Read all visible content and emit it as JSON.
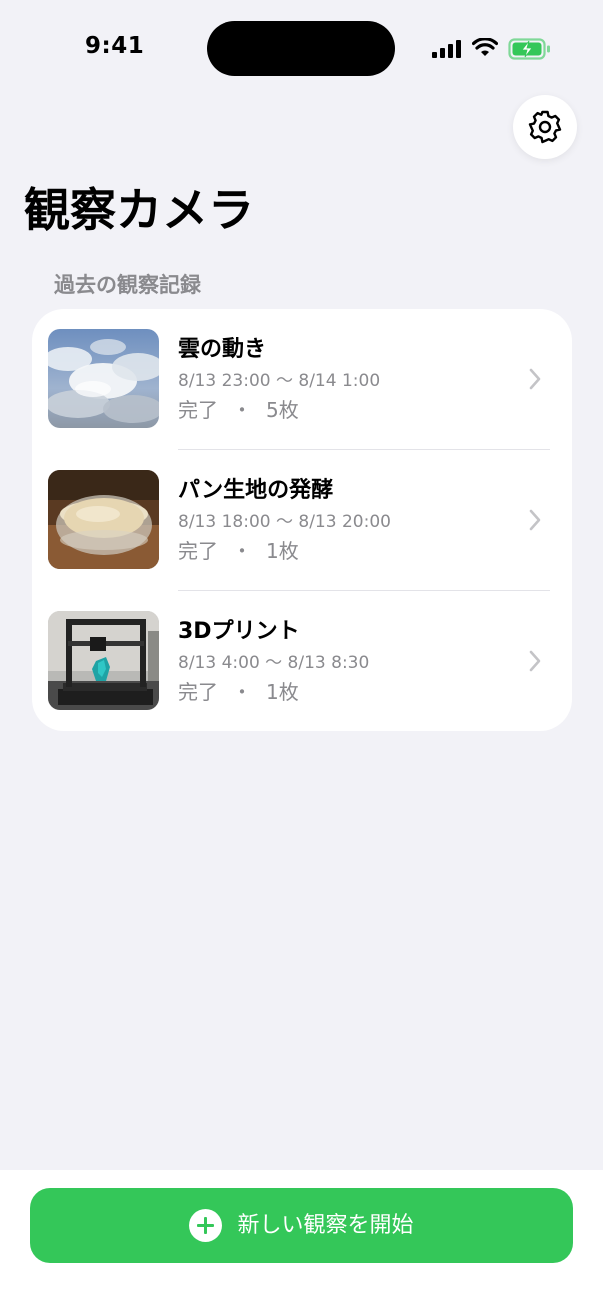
{
  "status_bar": {
    "time": "9:41",
    "icons": [
      "cellular-signal-icon",
      "wifi-icon",
      "battery-charging-icon"
    ]
  },
  "header": {
    "settings_icon": "gear-icon",
    "title": "観察カメラ"
  },
  "section": {
    "header": "過去の観察記録"
  },
  "records": [
    {
      "title": "雲の動き",
      "period": "8/13 23:00 〜 8/14 1:00",
      "status": "完了",
      "separator": "・",
      "count": "5枚",
      "thumbnail": "clouds-photo"
    },
    {
      "title": "パン生地の発酵",
      "period": "8/13 18:00 〜 8/13 20:00",
      "status": "完了",
      "separator": "・",
      "count": "1枚",
      "thumbnail": "bread-dough-photo"
    },
    {
      "title": "3Dプリント",
      "period": "8/13 4:00 〜 8/13 8:30",
      "status": "完了",
      "separator": "・",
      "count": "1枚",
      "thumbnail": "3d-printer-photo"
    }
  ],
  "bottom": {
    "start_icon": "plus-circle-icon",
    "start_label": "新しい観察を開始"
  },
  "colors": {
    "background": "#f2f2f7",
    "accent_green": "#34c759",
    "secondary_text": "#8a8a8e",
    "battery_green": "#34c759"
  }
}
